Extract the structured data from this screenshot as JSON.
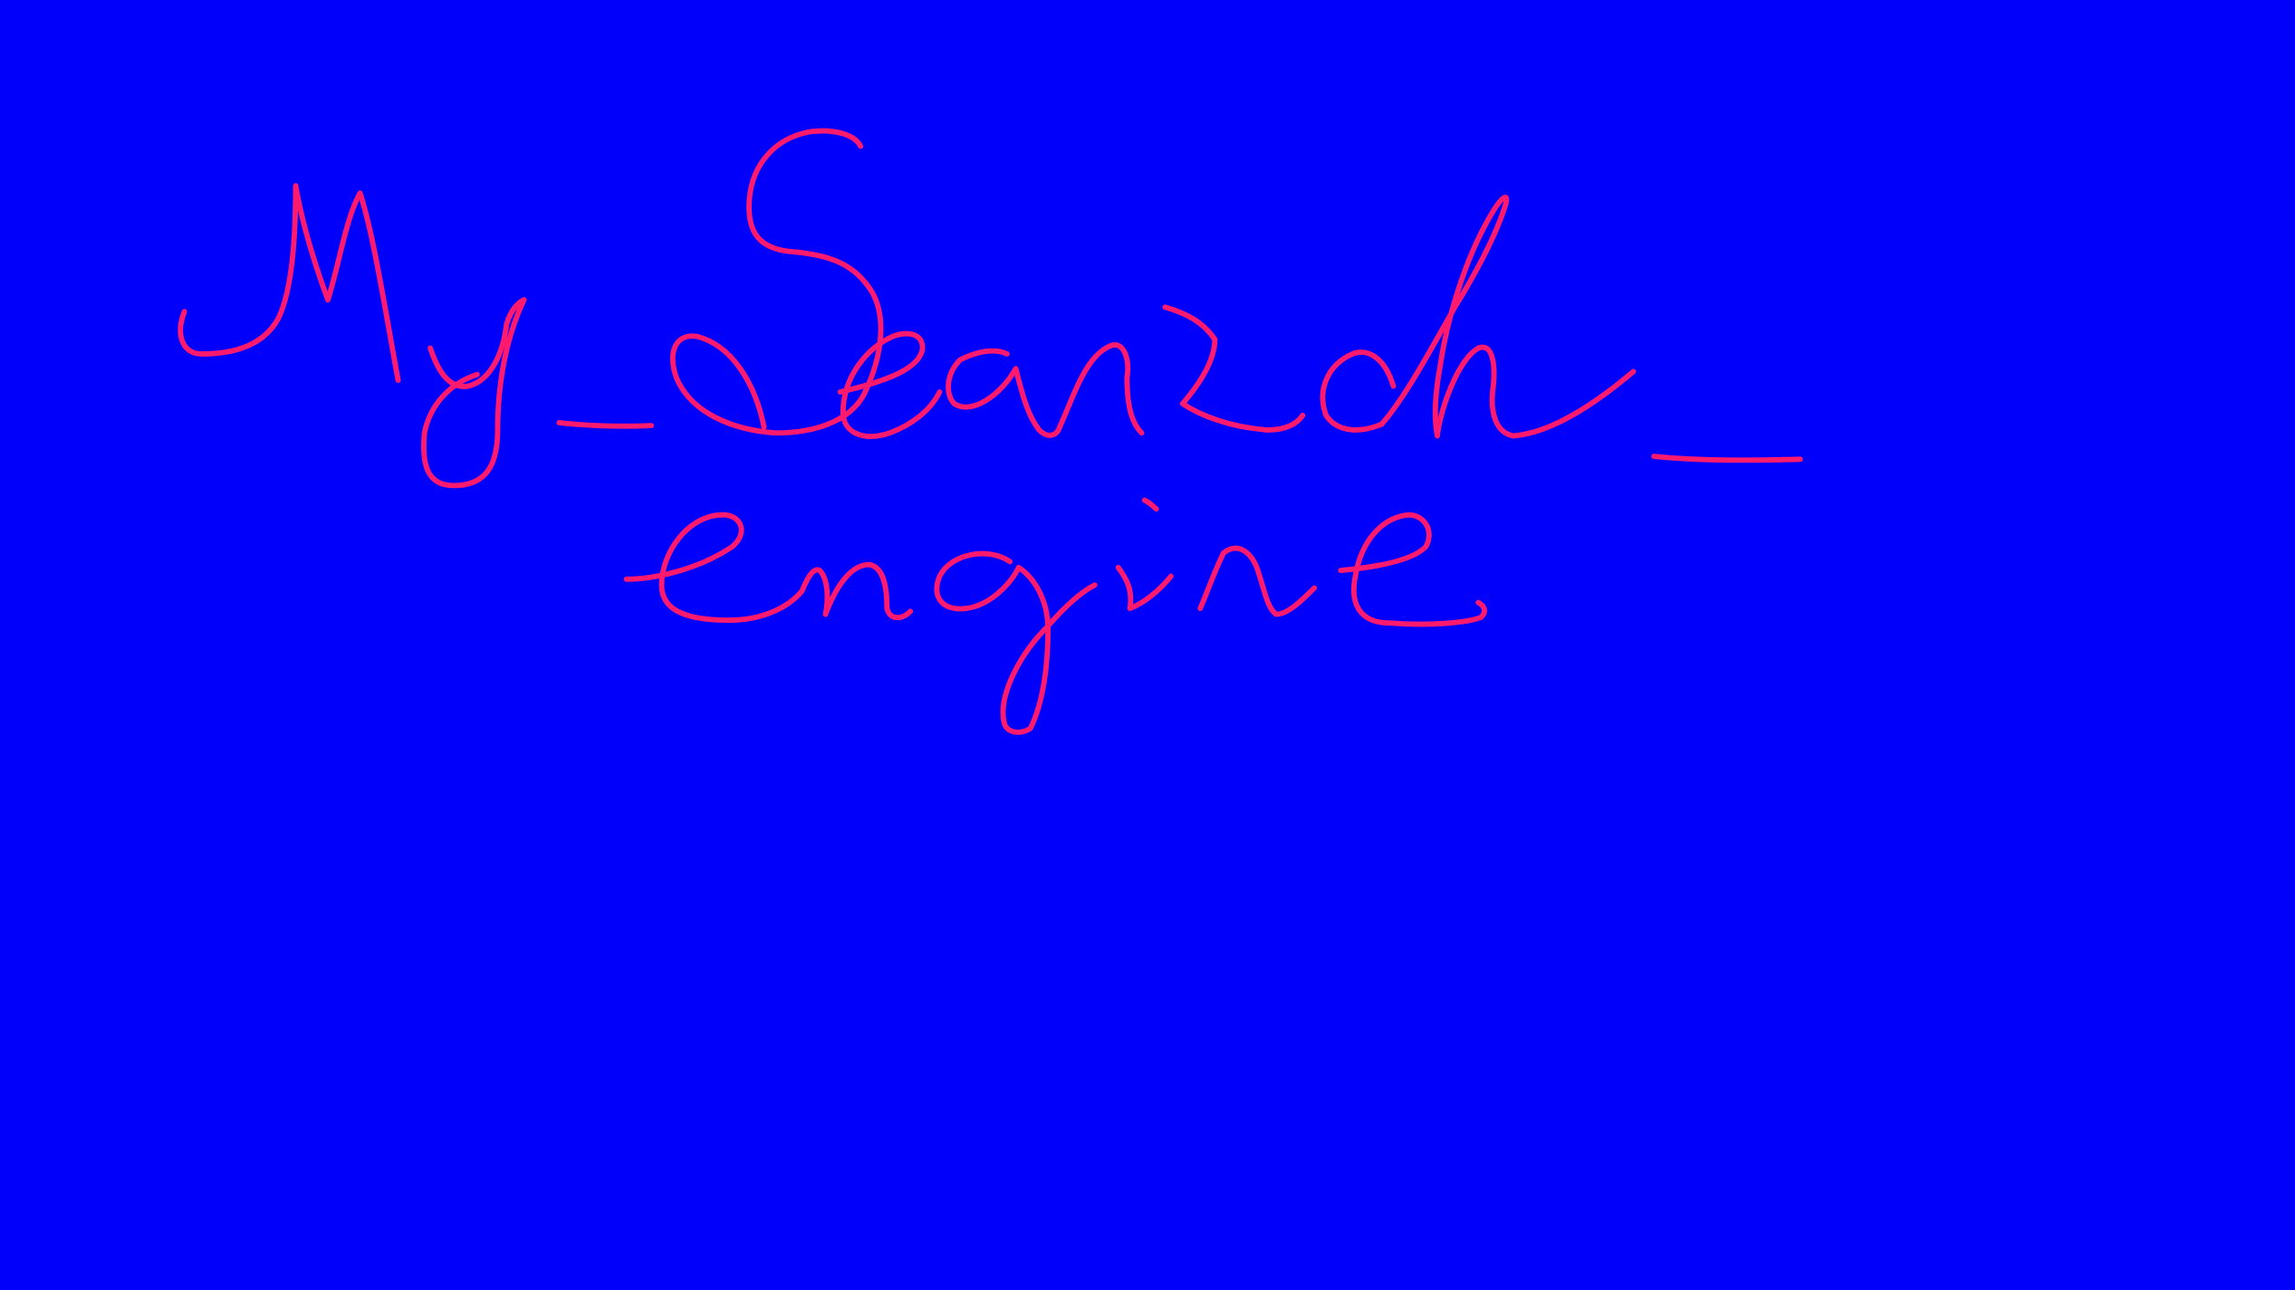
{
  "canvas": {
    "background_color": "#0000fb",
    "ink_color": "#ff1a6e"
  },
  "handwriting": {
    "line1": "My_Search_",
    "line2": "engine"
  }
}
